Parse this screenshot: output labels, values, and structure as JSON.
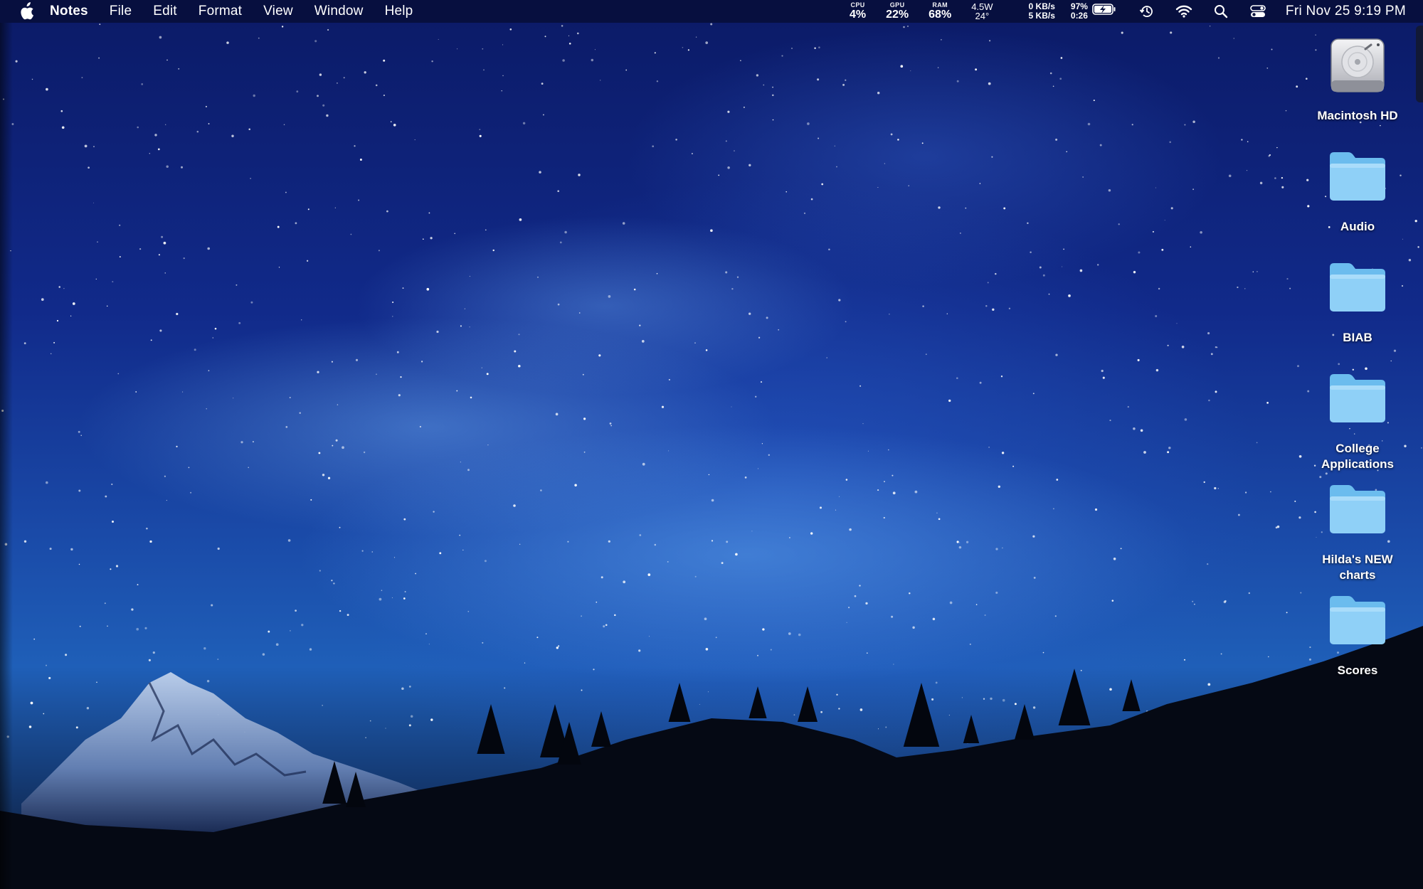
{
  "menubar": {
    "apple_icon": "apple-logo-icon",
    "app_name": "Notes",
    "menus": [
      "File",
      "Edit",
      "Format",
      "View",
      "Window",
      "Help"
    ],
    "status": {
      "cpu_label": "CPU",
      "cpu_value": "4%",
      "gpu_label": "GPU",
      "gpu_value": "22%",
      "ram_label": "RAM",
      "ram_value": "68%",
      "power": "4.5W",
      "temperature": "24°",
      "net_down": "0 KB/s",
      "net_up": "5 KB/s",
      "battery_percent": "97%",
      "battery_time": "0:26"
    },
    "icons": [
      "battery-charging-icon",
      "time-machine-icon",
      "wifi-icon",
      "spotlight-search-icon",
      "control-center-icon"
    ],
    "clock": "Fri Nov 25  9:19 PM"
  },
  "desktop": {
    "icons": [
      {
        "label": "Macintosh HD",
        "type": "hard-drive-icon"
      },
      {
        "label": "Audio",
        "type": "folder-icon"
      },
      {
        "label": "BIAB",
        "type": "folder-icon"
      },
      {
        "label": "College Applications",
        "type": "folder-icon"
      },
      {
        "label": "Hilda's NEW charts",
        "type": "folder-icon"
      },
      {
        "label": "Scores",
        "type": "folder-icon"
      }
    ],
    "colors": {
      "folder_front": "#8fd0f7",
      "folder_back": "#6bbcee",
      "menubar": "#080e3c"
    }
  }
}
